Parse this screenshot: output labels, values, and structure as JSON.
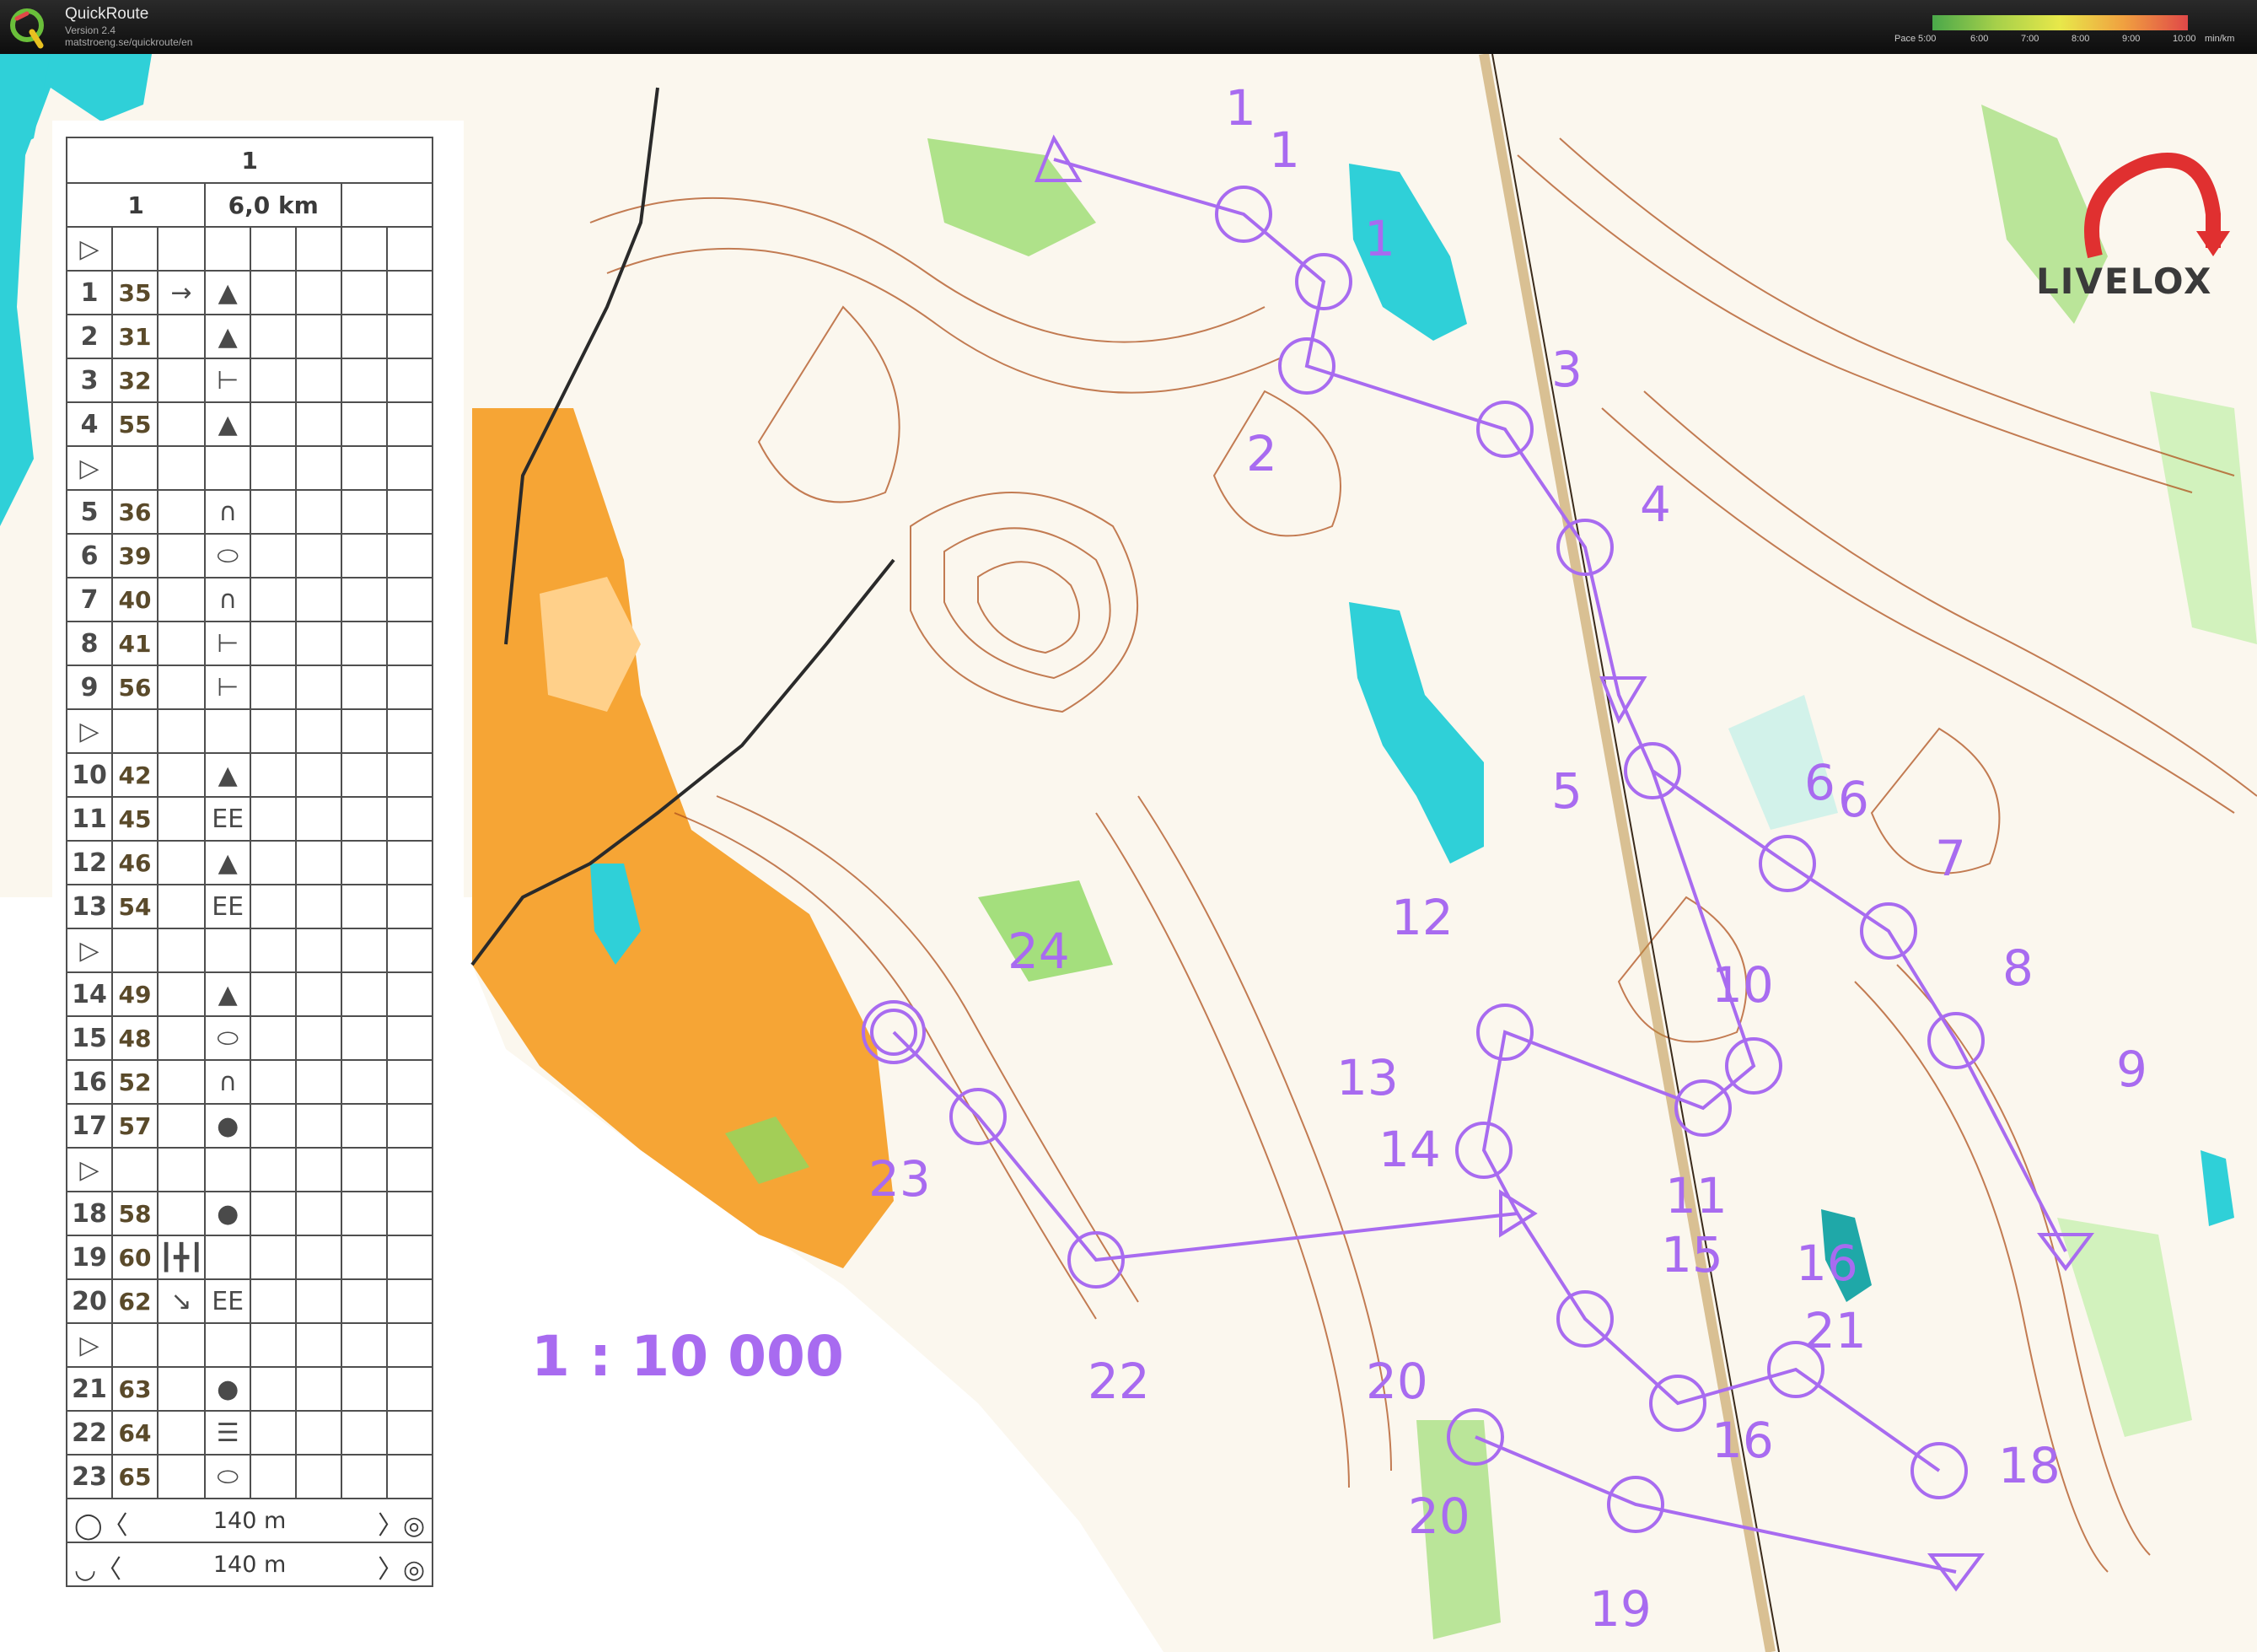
{
  "app": {
    "title": "QuickRoute",
    "version": "Version 2.4",
    "url": "matstroeng.se/quickroute/en",
    "logo_letter": "Q"
  },
  "pace_scale": {
    "label": "Pace",
    "ticks": [
      "5:00",
      "6:00",
      "7:00",
      "8:00",
      "9:00",
      "10:00"
    ],
    "unit": "min/km"
  },
  "course": {
    "header": "1",
    "name": "1",
    "length": "6,0 km",
    "legs": [
      {
        "n": "",
        "code": "",
        "dir": "",
        "sym": "start"
      },
      {
        "n": "1",
        "code": "35",
        "dir": "→",
        "sym": "knoll"
      },
      {
        "n": "2",
        "code": "31",
        "dir": "",
        "sym": "knoll"
      },
      {
        "n": "3",
        "code": "32",
        "dir": "",
        "sym": "spur"
      },
      {
        "n": "4",
        "code": "55",
        "dir": "",
        "sym": "knoll"
      },
      {
        "n": "",
        "code": "",
        "dir": "",
        "sym": "start"
      },
      {
        "n": "5",
        "code": "36",
        "dir": "",
        "sym": "hill"
      },
      {
        "n": "6",
        "code": "39",
        "dir": "",
        "sym": "oval"
      },
      {
        "n": "7",
        "code": "40",
        "dir": "",
        "sym": "hill"
      },
      {
        "n": "8",
        "code": "41",
        "dir": "",
        "sym": "spur"
      },
      {
        "n": "9",
        "code": "56",
        "dir": "",
        "sym": "spur"
      },
      {
        "n": "",
        "code": "",
        "dir": "",
        "sym": "start"
      },
      {
        "n": "10",
        "code": "42",
        "dir": "",
        "sym": "knoll"
      },
      {
        "n": "11",
        "code": "45",
        "dir": "",
        "sym": "cliff"
      },
      {
        "n": "12",
        "code": "46",
        "dir": "",
        "sym": "knoll"
      },
      {
        "n": "13",
        "code": "54",
        "dir": "",
        "sym": "cliff"
      },
      {
        "n": "",
        "code": "",
        "dir": "",
        "sym": "start"
      },
      {
        "n": "14",
        "code": "49",
        "dir": "",
        "sym": "knoll"
      },
      {
        "n": "15",
        "code": "48",
        "dir": "",
        "sym": "oval"
      },
      {
        "n": "16",
        "code": "52",
        "dir": "",
        "sym": "hill"
      },
      {
        "n": "17",
        "code": "57",
        "dir": "",
        "sym": "dot"
      },
      {
        "n": "",
        "code": "",
        "dir": "",
        "sym": "start"
      },
      {
        "n": "18",
        "code": "58",
        "dir": "",
        "sym": "dot"
      },
      {
        "n": "19",
        "code": "60",
        "dir": "┃╋┃",
        "sym": ""
      },
      {
        "n": "20",
        "code": "62",
        "dir": "↘",
        "sym": "cliff"
      },
      {
        "n": "",
        "code": "",
        "dir": "",
        "sym": "start"
      },
      {
        "n": "21",
        "code": "63",
        "dir": "",
        "sym": "dot"
      },
      {
        "n": "22",
        "code": "64",
        "dir": "",
        "sym": "stairs"
      },
      {
        "n": "23",
        "code": "65",
        "dir": "",
        "sym": "oval"
      }
    ],
    "finish_rows": [
      {
        "distance": "140 m"
      },
      {
        "distance": "140 m"
      }
    ]
  },
  "map": {
    "scale_text": "1 : 10 000",
    "watermark": "LIVELOX",
    "control_labels": [
      "1",
      "1",
      "1",
      "2",
      "3",
      "4",
      "5",
      "6",
      "6",
      "7",
      "8",
      "9",
      "10",
      "11",
      "12",
      "13",
      "14",
      "15",
      "16",
      "16",
      "18",
      "19",
      "20",
      "20",
      "21",
      "22",
      "23",
      "24"
    ]
  },
  "colors": {
    "purple": "#a86bf0",
    "orange": "#f5a02a",
    "water": "#2fd0d8",
    "green": "#8fd860",
    "brown": "#b0521e"
  }
}
